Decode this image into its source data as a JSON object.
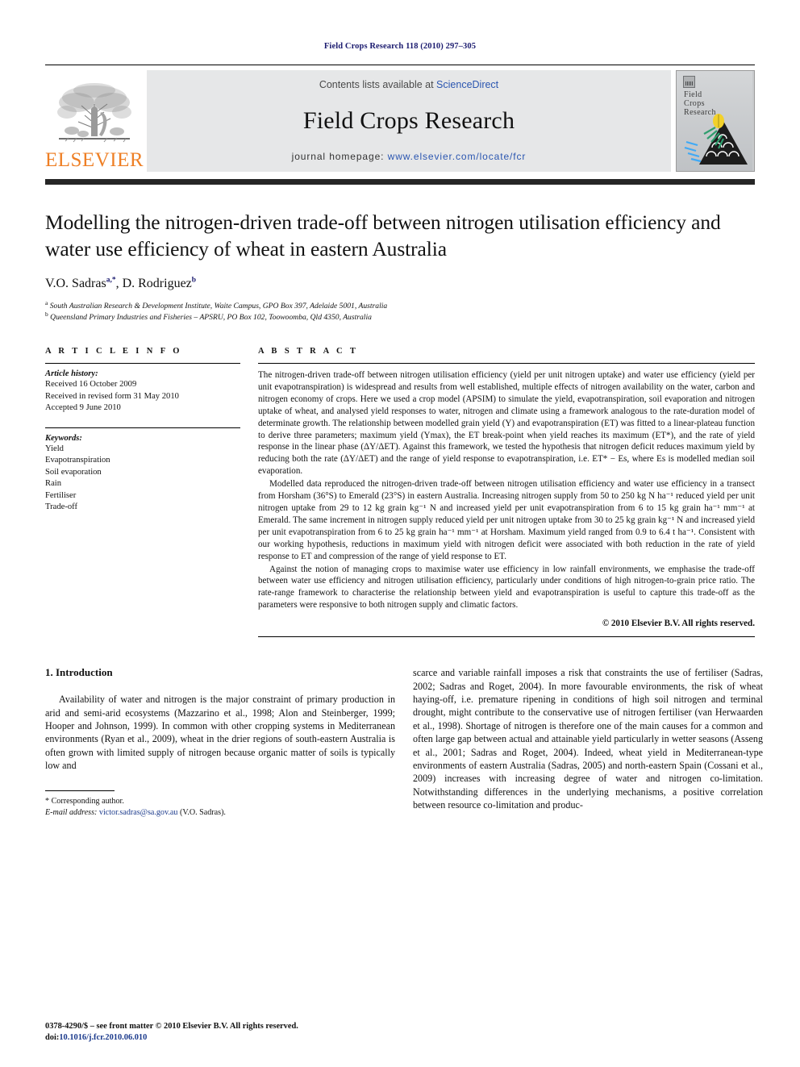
{
  "running_head": "Field Crops Research 118 (2010) 297–305",
  "masthead": {
    "contents_prefix": "Contents lists available at ",
    "contents_link": "ScienceDirect",
    "journal_name": "Field Crops Research",
    "homepage_prefix": "journal homepage:",
    "homepage_url": "www.elsevier.com/locate/fcr",
    "publisher_name": "ELSEVIER",
    "publisher_logo": "elsevier-tree-logo",
    "cover_title_line1": "Field",
    "cover_title_line2": "Crops",
    "cover_title_line3": "Research",
    "accent_orange": "#ee7f25",
    "link_blue": "#2b56b0",
    "band_gray": "#e6e7e8"
  },
  "article": {
    "title": "Modelling the nitrogen-driven trade-off between nitrogen utilisation efficiency and water use efficiency of wheat in eastern Australia",
    "authors_part1": "V.O. Sadras",
    "authors_sup1": "a,*",
    "authors_part2": ", D. Rodriguez",
    "authors_sup2": "b",
    "affiliation_a_sup": "a",
    "affiliation_a": "South Australian Research & Development Institute, Waite Campus, GPO Box 397, Adelaide 5001, Australia",
    "affiliation_b_sup": "b",
    "affiliation_b": "Queensland Primary Industries and Fisheries – APSRU, PO Box 102, Toowoomba, Qld 4350, Australia"
  },
  "article_info": {
    "heading": "A R T I C L E    I N F O",
    "history_title": "Article history:",
    "history": [
      "Received 16 October 2009",
      "Received in revised form 31 May 2010",
      "Accepted 9 June 2010"
    ],
    "keywords_title": "Keywords:",
    "keywords": [
      "Yield",
      "Evapotranspiration",
      "Soil evaporation",
      "Rain",
      "Fertiliser",
      "Trade-off"
    ]
  },
  "abstract": {
    "heading": "A B S T R A C T",
    "paragraph_1": "The nitrogen-driven trade-off between nitrogen utilisation efficiency (yield per unit nitrogen uptake) and water use efficiency (yield per unit evapotranspiration) is widespread and results from well established, multiple effects of nitrogen availability on the water, carbon and nitrogen economy of crops. Here we used a crop model (APSIM) to simulate the yield, evapotranspiration, soil evaporation and nitrogen uptake of wheat, and analysed yield responses to water, nitrogen and climate using a framework analogous to the rate-duration model of determinate growth. The relationship between modelled grain yield (Y) and evapotranspiration (ET) was fitted to a linear-plateau function to derive three parameters; maximum yield (Ymax), the ET break-point when yield reaches its maximum (ET*), and the rate of yield response in the linear phase (ΔY/ΔET). Against this framework, we tested the hypothesis that nitrogen deficit reduces maximum yield by reducing both the rate (ΔY/ΔET) and the range of yield response to evapotranspiration, i.e. ET* − Es, where Es is modelled median soil evaporation.",
    "paragraph_2": "Modelled data reproduced the nitrogen-driven trade-off between nitrogen utilisation efficiency and water use efficiency in a transect from Horsham (36°S) to Emerald (23°S) in eastern Australia. Increasing nitrogen supply from 50 to 250 kg N ha⁻¹ reduced yield per unit nitrogen uptake from 29 to 12 kg grain kg⁻¹ N and increased yield per unit evapotranspiration from 6 to 15 kg grain ha⁻¹ mm⁻¹ at Emerald. The same increment in nitrogen supply reduced yield per unit nitrogen uptake from 30 to 25 kg grain kg⁻¹ N and increased yield per unit evapotranspiration from 6 to 25 kg grain ha⁻¹ mm⁻¹ at Horsham. Maximum yield ranged from 0.9 to 6.4 t ha⁻¹. Consistent with our working hypothesis, reductions in maximum yield with nitrogen deficit were associated with both reduction in the rate of yield response to ET and compression of the range of yield response to ET.",
    "paragraph_3": "Against the notion of managing crops to maximise water use efficiency in low rainfall environments, we emphasise the trade-off between water use efficiency and nitrogen utilisation efficiency, particularly under conditions of high nitrogen-to-grain price ratio. The rate-range framework to characterise the relationship between yield and evapotranspiration is useful to capture this trade-off as the parameters were responsive to both nitrogen supply and climatic factors.",
    "copyright": "© 2010 Elsevier B.V. All rights reserved."
  },
  "body": {
    "section_heading": "1.  Introduction",
    "left_paragraph": "Availability of water and nitrogen is the major constraint of primary production in arid and semi-arid ecosystems (Mazzarino et al., 1998; Alon and Steinberger, 1999; Hooper and Johnson, 1999). In common with other cropping systems in Mediterranean environments (Ryan et al., 2009), wheat in the drier regions of south-eastern Australia is often grown with limited supply of nitrogen because organic matter of soils is typically low and",
    "right_paragraph": "scarce and variable rainfall imposes a risk that constraints the use of fertiliser (Sadras, 2002; Sadras and Roget, 2004). In more favourable environments, the risk of wheat haying-off, i.e. premature ripening in conditions of high soil nitrogen and terminal drought, might contribute to the conservative use of nitrogen fertiliser (van Herwaarden et al., 1998). Shortage of nitrogen is therefore one of the main causes for a common and often large gap between actual and attainable yield particularly in wetter seasons (Asseng et al., 2001; Sadras and Roget, 2004). Indeed, wheat yield in Mediterranean-type environments of eastern Australia (Sadras, 2005) and north-eastern Spain (Cossani et al., 2009) increases with increasing degree of water and nitrogen co-limitation. Notwithstanding differences in the underlying mechanisms, a positive correlation between resource co-limitation and produc-"
  },
  "footnotes": {
    "corresponding": "* Corresponding author.",
    "email_label": "E-mail address:",
    "email": "victor.sadras@sa.gov.au",
    "email_owner": "(V.O. Sadras)."
  },
  "imprint": {
    "issn_line": "0378-4290/$ – see front matter © 2010 Elsevier B.V. All rights reserved.",
    "doi_label": "doi:",
    "doi": "10.1016/j.fcr.2010.06.010"
  }
}
